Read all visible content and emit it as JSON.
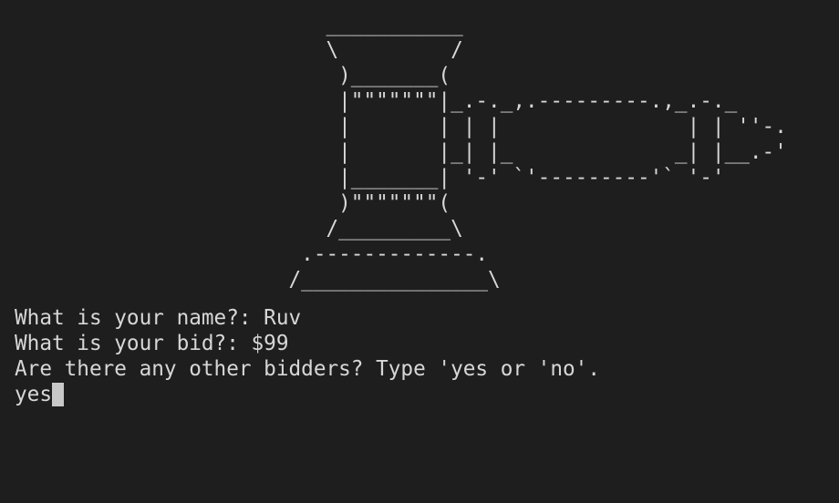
{
  "terminal": {
    "ascii_logo": "                         ___________\n                         \\         /\n                          )_______(\n                          |\"\"\"\"\"\"\"|_.-._,.---------.,_.-._\n                          |       | | |               | | ''-.\n                          |       |_| |_             _| |__.-'\n                          |_______| '-' `'---------'` '-'\n                          )\"\"\"\"\"\"\"(\n                         /_________\\\n                       .-------------.\n                      /_______________\\",
    "lines": [
      "What is your name?: Ruv",
      "What is your bid?: $99",
      "Are there any other bidders? Type 'yes or 'no'."
    ],
    "current_input": "yes"
  },
  "colors": {
    "background": "#1e1e1e",
    "foreground": "#d7d7d7",
    "cursor": "#c8c8c8"
  }
}
